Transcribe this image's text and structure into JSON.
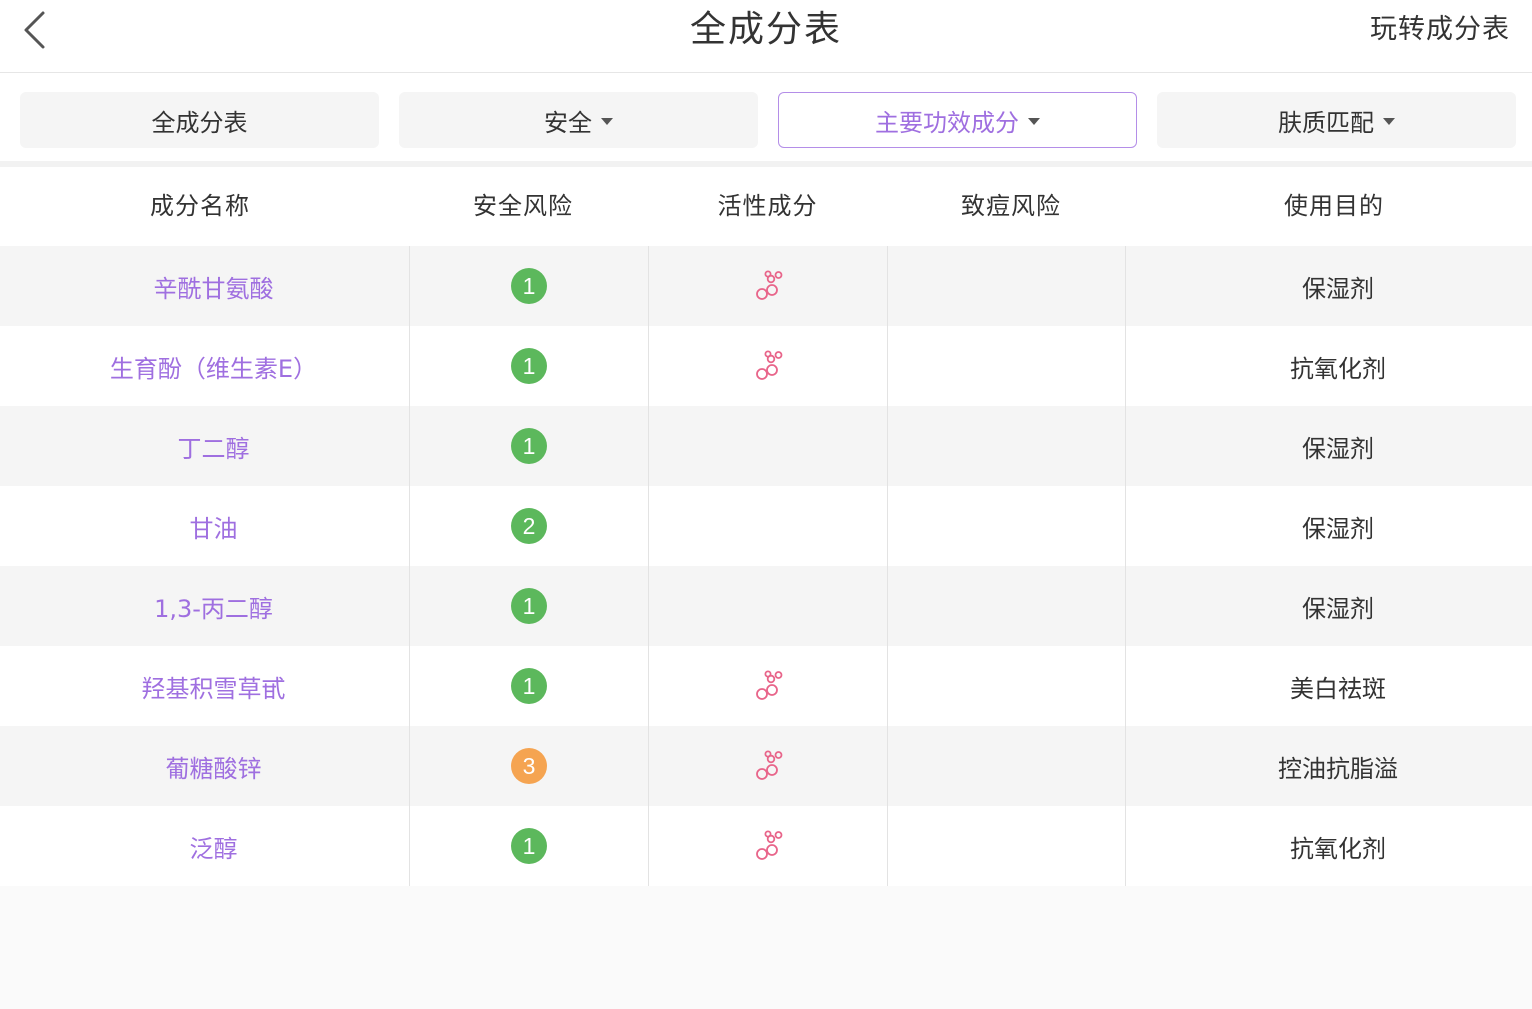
{
  "nav": {
    "back_icon": "chevron-left-icon",
    "title": "全成分表",
    "right_link": "玩转成分表"
  },
  "filters": [
    {
      "label": "全成分表",
      "has_dropdown": false,
      "active": false
    },
    {
      "label": "安全",
      "has_dropdown": true,
      "active": false
    },
    {
      "label": "主要功效成分",
      "has_dropdown": true,
      "active": true
    },
    {
      "label": "肤质匹配",
      "has_dropdown": true,
      "active": false
    }
  ],
  "table": {
    "headers": [
      "成分名称",
      "安全风险",
      "活性成分",
      "致痘风险",
      "使用目的"
    ],
    "rows": [
      {
        "name": "辛酰甘氨酸",
        "risk": "1",
        "active": true,
        "acne": "",
        "purpose": "保湿剂"
      },
      {
        "name": "生育酚（维生素E）",
        "risk": "1",
        "active": true,
        "acne": "",
        "purpose": "抗氧化剂"
      },
      {
        "name": "丁二醇",
        "risk": "1",
        "active": false,
        "acne": "",
        "purpose": "保湿剂"
      },
      {
        "name": "甘油",
        "risk": "2",
        "active": false,
        "acne": "",
        "purpose": "保湿剂"
      },
      {
        "name": "1,3-丙二醇",
        "risk": "1",
        "active": false,
        "acne": "",
        "purpose": "保湿剂"
      },
      {
        "name": "羟基积雪草甙",
        "risk": "1",
        "active": true,
        "acne": "",
        "purpose": "美白祛斑"
      },
      {
        "name": "葡糖酸锌",
        "risk": "3",
        "active": true,
        "acne": "",
        "purpose": "控油抗脂溢"
      },
      {
        "name": "泛醇",
        "risk": "1",
        "active": true,
        "acne": "",
        "purpose": "抗氧化剂"
      }
    ]
  },
  "colors": {
    "accent": "#9f6fe0",
    "active_icon": "#e8658a",
    "risk_low": "#5cb85c",
    "risk_mid": "#f5a451",
    "row_alt": "#f5f5f5"
  },
  "icons": {
    "active_ingredient": "molecule-icon",
    "dropdown": "caret-down-icon"
  }
}
